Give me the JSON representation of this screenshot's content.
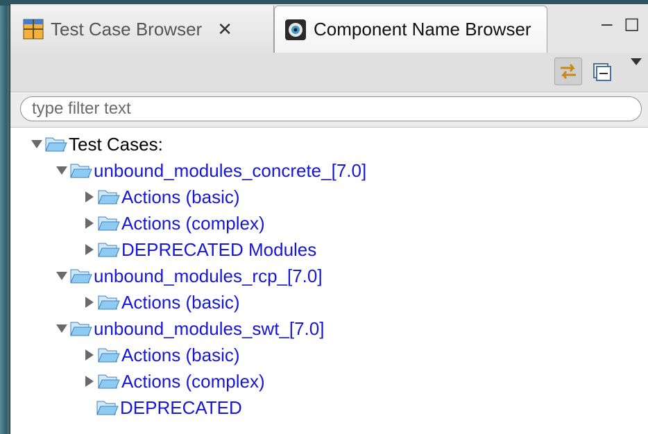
{
  "tabs": {
    "test_case_browser": "Test Case Browser",
    "component_name_browser": "Component Name Browser"
  },
  "filter": {
    "placeholder": "type filter text",
    "value": ""
  },
  "icons": {
    "tab1": "test-case-grid-icon",
    "tab2": "component-name-icon",
    "close": "close-icon",
    "minimize": "minimize-icon",
    "maximize": "maximize-icon",
    "link": "link-with-editor-icon",
    "collapse": "collapse-all-icon",
    "menu": "view-menu-icon",
    "folder": "folder-icon"
  },
  "colors": {
    "link_text": "#1616d8",
    "folder_fill": "#8ecbf2",
    "folder_edge": "#3c7fbf"
  },
  "tree": {
    "root": "Test Cases:",
    "n1": "unbound_modules_concrete_[7.0]",
    "n1_a": "Actions (basic)",
    "n1_b": "Actions (complex)",
    "n1_c": "DEPRECATED Modules",
    "n2": "unbound_modules_rcp_[7.0]",
    "n2_a": "Actions (basic)",
    "n3": "unbound_modules_swt_[7.0]",
    "n3_a": "Actions (basic)",
    "n3_b": "Actions (complex)",
    "n3_c": "DEPRECATED"
  }
}
